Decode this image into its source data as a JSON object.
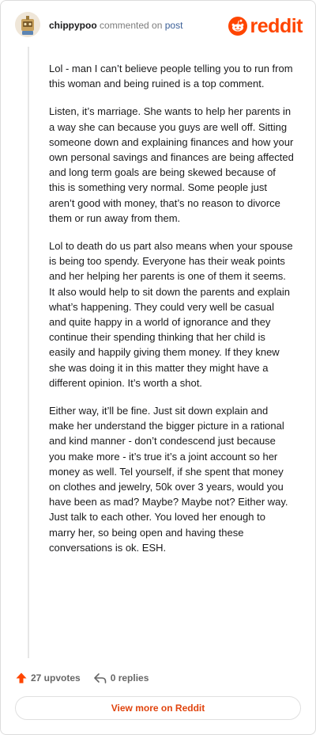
{
  "comment": {
    "username": "chippypoo",
    "action_text": "commented on",
    "link_text": "post",
    "brand": "reddit",
    "paragraphs": [
      "Lol - man I can’t believe people telling you to run from this woman and being ruined is a top comment.",
      "Listen, it’s marriage. She wants to help her parents in a way she can because you guys are well off. Sitting someone down and explaining finances and how your own personal savings and finances are being affected and long term goals are being skewed because of this is something very normal. Some people just aren’t good with money, that’s no reason to divorce them or run away from them.",
      "Lol to death do us part also means when your spouse is being too spendy. Everyone has their weak points and her helping her parents is one of them it seems. It also would help to sit down the parents and explain what’s happening. They could very well be casual and quite happy in a world of ignorance and they continue their spending thinking that her child is easily and happily giving them money. If they knew she was doing it in this matter they might have a different opinion. It’s worth a shot.",
      "Either way, it’ll be fine. Just sit down explain and make her understand the bigger picture in a rational and kind manner - don’t condescend just because you make more - it’s true it’s a joint account so her money as well. Tel yourself, if she spent that money on clothes and jewelry, 50k over 3 years, would you have been as mad? Maybe? Maybe not? Either way. Just talk to each other. You loved her enough to marry her, so being open and having these conversations is ok. ESH."
    ],
    "upvotes": "27 upvotes",
    "replies": "0 replies",
    "view_more": "View more on Reddit"
  },
  "colors": {
    "brand": "#ff4500",
    "link": "#3a5f97",
    "button_text": "#e0440e"
  },
  "icons": [
    "avatar",
    "reddit-logo-icon",
    "upvote-arrow-icon",
    "reply-icon"
  ]
}
